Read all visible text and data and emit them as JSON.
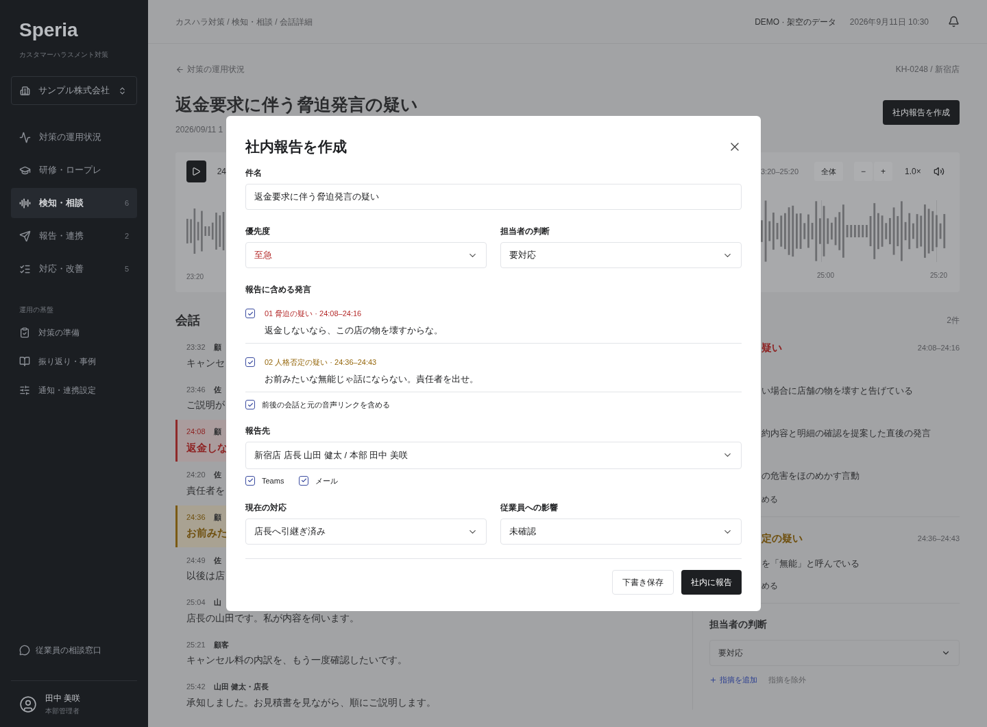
{
  "sidebar": {
    "logo": "Speria",
    "tagline": "カスタマーハラスメント対策",
    "org": "サンプル株式会社",
    "nav": [
      {
        "label": "対策の運用状況",
        "selected": false
      },
      {
        "label": "研修・ロープレ",
        "selected": false
      },
      {
        "label": "検知・相談",
        "count": "6",
        "selected": true
      },
      {
        "label": "報告・連携",
        "count": "2",
        "selected": false
      },
      {
        "label": "対応・改善",
        "count": "5",
        "selected": false
      }
    ],
    "section_title": "運用の基盤",
    "nav2": [
      {
        "label": "対策の準備",
        "selected": false
      },
      {
        "label": "振り返り・事例",
        "selected": false
      },
      {
        "label": "通知・連携設定",
        "selected": false
      }
    ],
    "help_link": "従業員の相談窓口",
    "user": {
      "name": "田中 美咲",
      "role": "本部管理者"
    }
  },
  "header": {
    "breadcrumb": "カスハラ対策 / 検知・相談 / 会話詳細",
    "demo_label": "DEMO · 架空のデータ",
    "datetime": "2026年9月11日 10:30"
  },
  "page": {
    "back_link": "対策の運用状況",
    "case_ref": "KH-0248 / 新宿店",
    "title": "返金要求に伴う脅迫発言の疑い",
    "date_fragment": "2026/09/11 1",
    "create_button": "社内報告を作成"
  },
  "player": {
    "time_fragment": "24",
    "start_tick": "23:20",
    "range": "3:20–25:20",
    "full_button": "全体",
    "zoom_out": "−",
    "zoom_in": "+",
    "speed": "1.0×",
    "ticks": [
      "25:00",
      "25:20"
    ]
  },
  "conversation": {
    "title": "会話",
    "rows": [
      {
        "time": "23:32",
        "speaker": "顧",
        "text": "キャンセ",
        "kind": "normal"
      },
      {
        "time": "23:46",
        "speaker": "佐",
        "text": "ご説明が",
        "kind": "normal"
      },
      {
        "time": "24:08",
        "speaker": "顧",
        "text": "返金しな",
        "kind": "threat"
      },
      {
        "time": "24:20",
        "speaker": "佐",
        "text": "責任者を",
        "kind": "normal"
      },
      {
        "time": "24:36",
        "speaker": "顧",
        "text": "お前みた",
        "kind": "insult"
      },
      {
        "time": "24:49",
        "speaker": "佐",
        "text": "以後は店",
        "kind": "normal"
      },
      {
        "time": "25:04",
        "speaker": "山",
        "text": "店長の山田です。私が内容を伺います。",
        "kind": "normal"
      },
      {
        "time": "25:21",
        "speaker": "顧客",
        "text": "キャンセル料の内訳を、もう一度確認したいです。",
        "kind": "normal"
      },
      {
        "time": "25:42",
        "speaker": "山田 健太・店長",
        "text": "承知しました。お見積書を見ながら、順にご説明します。",
        "kind": "normal"
      }
    ]
  },
  "findings": {
    "count": "2件",
    "items": [
      {
        "title": "疑い",
        "time": "24:08–24:16",
        "kind": "threat",
        "details": [
          "い場合に店舗の物を壊すと告げている",
          "約内容と明細の確認を提案した直後の発言",
          "の危害をほのめかす言動"
        ],
        "include": "める"
      },
      {
        "title": "定の疑い",
        "time": "24:36–24:43",
        "kind": "insult",
        "details": [
          "を「無能」と呼んでいる"
        ],
        "include": "める"
      }
    ]
  },
  "judgement": {
    "title": "担当者の判断",
    "value": "要対応",
    "add_link": "指摘を追加",
    "exclude_link": "指摘を除外"
  },
  "modal": {
    "title": "社内報告を作成",
    "subject": {
      "label": "件名",
      "value": "返金要求に伴う脅迫発言の疑い"
    },
    "priority": {
      "label": "優先度",
      "value": "至急",
      "kind": "threat"
    },
    "judgement": {
      "label": "担当者の判断",
      "value": "要対応"
    },
    "utterances": {
      "label": "報告に含める発言",
      "items": [
        {
          "header": "01 脅迫の疑い · 24:08–24:16",
          "text": "返金しないなら、この店の物を壊すからな。",
          "kind": "threat",
          "checked": true
        },
        {
          "header": "02 人格否定の疑い · 24:36–24:43",
          "text": "お前みたいな無能じゃ話にならない。責任者を出せ。",
          "kind": "insult",
          "checked": true
        }
      ]
    },
    "include_context": {
      "label": "前後の会話と元の音声リンクを含める",
      "checked": true
    },
    "recipients": {
      "label": "報告先",
      "value": "新宿店 店長 山田 健太 / 本部 田中 美咲",
      "channels": [
        {
          "label": "Teams",
          "checked": true
        },
        {
          "label": "メール",
          "checked": true
        }
      ]
    },
    "current_action": {
      "label": "現在の対応",
      "value": "店長へ引継ぎ済み"
    },
    "employee_impact": {
      "label": "従業員への影響",
      "value": "未確認"
    },
    "draft_button": "下書き保存",
    "submit_button": "社内に報告"
  }
}
